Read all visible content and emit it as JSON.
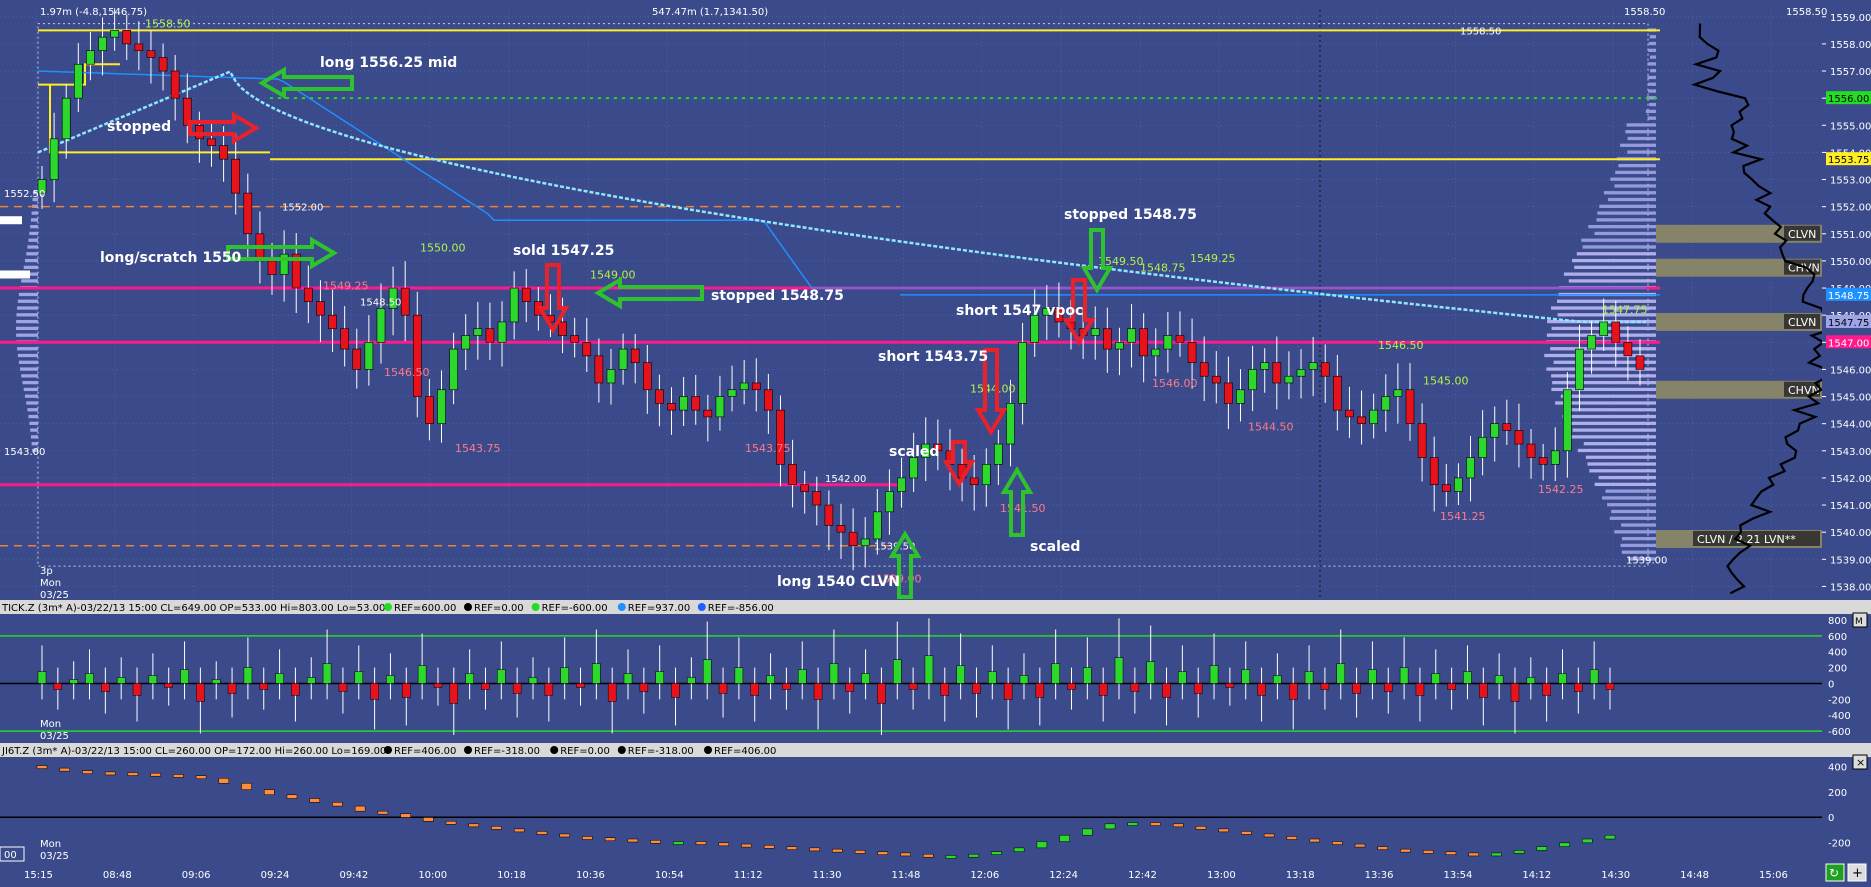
{
  "colors": {
    "background": "#3a4a8a",
    "grid": "#52609e",
    "up_candle": "#2bd82b",
    "down_candle": "#e8121c",
    "vwap_light": "#8fe8ff",
    "vwap_blue": "#1e90ff",
    "yellow_level": "#ffee22",
    "magenta_level": "#ff1a8c",
    "orange_dash": "#e8843c",
    "green_dotted": "#22dd22",
    "profile": "#9ea4e6",
    "profile_value": "#bdb8f4",
    "zone_fill": "#8e8a64",
    "arrow_green": "#2ec22e",
    "arrow_red": "#e8212b",
    "price_label_red": "#ff7a8a",
    "price_label_green": "#b6f04a",
    "annotation_text": "#ffffff"
  },
  "main_panel": {
    "header_left": "1.97m (-4.8,1546.75)",
    "header_mid": "547.47m (1.7,1341.50)",
    "header_right": "1558.50",
    "top_right_label": "1558.50",
    "price_axis_ticks": [
      "1559.00",
      "1558.00",
      "1557.00",
      "1556.00",
      "1555.00",
      "1554.00",
      "1553.00",
      "1552.00",
      "1551.00",
      "1550.00",
      "1549.00",
      "1548.00",
      "1547.00",
      "1546.00",
      "1545.00",
      "1544.00",
      "1543.00",
      "1542.00",
      "1541.00",
      "1540.00",
      "1539.00",
      "1538.00"
    ],
    "price_markers": [
      {
        "label": "1556.00",
        "price": 1556.0,
        "bg": "#22dd22",
        "fg": "#000000"
      },
      {
        "label": "1553.75",
        "price": 1553.75,
        "bg": "#ffee22",
        "fg": "#000000"
      },
      {
        "label": "1548.75",
        "price": 1548.75,
        "bg": "#1e90ff",
        "fg": "#ffffff"
      },
      {
        "label": "1547.75",
        "price": 1547.75,
        "bg": "#9ea4e6",
        "fg": "#000000"
      },
      {
        "label": "1547.00",
        "price": 1547.0,
        "bg": "#ff1a8c",
        "fg": "#ffffff"
      }
    ],
    "zones": [
      {
        "label": "CLVN",
        "price": 1551.0
      },
      {
        "label": "CHVN",
        "price": 1549.75
      },
      {
        "label": "CLVN",
        "price": 1547.75
      },
      {
        "label": "CHVN",
        "price": 1545.25
      },
      {
        "label": "CLVN / 2.21 LVN**",
        "price": 1539.75
      }
    ],
    "left_axis_labels": [
      {
        "text": "1552.50",
        "price": 1552.5
      },
      {
        "text": "1543.00",
        "price": 1543.0
      }
    ],
    "session_label_top": "3p",
    "session_label_day": "Mon",
    "session_label_date": "03/25",
    "inline_labels": [
      {
        "text": "1552.00",
        "price": 1552.0
      },
      {
        "text": "1548.50",
        "price": 1548.5
      },
      {
        "text": "1542.00",
        "price": 1542.0
      },
      {
        "text": "1539.50",
        "price": 1539.5
      },
      {
        "text": "1539.00",
        "price": 1539.0
      },
      {
        "text": "1558.50",
        "price": 1558.5
      }
    ],
    "swing_labels_green": [
      {
        "text": "1558.50",
        "price": 1558.5
      },
      {
        "text": "1550.00",
        "price": 1550.0
      },
      {
        "text": "1549.00",
        "price": 1549.0
      },
      {
        "text": "1549.50",
        "price": 1549.5
      },
      {
        "text": "1548.75",
        "price": 1548.75
      },
      {
        "text": "1549.25",
        "price": 1549.25
      },
      {
        "text": "1546.50",
        "price": 1546.5
      },
      {
        "text": "1545.00",
        "price": 1545.0
      },
      {
        "text": "1547.75",
        "price": 1547.75
      },
      {
        "text": "1544.00",
        "price": 1544.0
      }
    ],
    "swing_labels_red": [
      {
        "text": "1549.25",
        "price": 1549.25
      },
      {
        "text": "1546.50",
        "price": 1546.5
      },
      {
        "text": "1543.75",
        "price": 1543.75
      },
      {
        "text": "1543.75",
        "price": 1543.75
      },
      {
        "text": "1539.00",
        "price": 1539.0
      },
      {
        "text": "1541.50",
        "price": 1541.5
      },
      {
        "text": "1546.00",
        "price": 1546.0
      },
      {
        "text": "1544.50",
        "price": 1544.5
      },
      {
        "text": "1541.25",
        "price": 1541.25
      },
      {
        "text": "1542.25",
        "price": 1542.25
      }
    ],
    "annotations": [
      {
        "text": "long 1556.25 mid"
      },
      {
        "text": "stopped"
      },
      {
        "text": "long/scratch 1550"
      },
      {
        "text": "sold 1547.25"
      },
      {
        "text": "stopped 1548.75"
      },
      {
        "text": "short 1547 vpoc"
      },
      {
        "text": "stopped 1548.75"
      },
      {
        "text": "short 1543.75"
      },
      {
        "text": "scaled"
      },
      {
        "text": "scaled"
      },
      {
        "text": "long 1540 CLVN"
      }
    ]
  },
  "tick_panel": {
    "title": "TICK.Z (3m* A)-03/22/13 15:00 CL=649.00 OP=533.00 Hi=803.00 Lo=53.00",
    "refs": [
      {
        "text": "REF=600.00",
        "color": "#22dd22"
      },
      {
        "text": "REF=0.00",
        "color": "#000000"
      },
      {
        "text": "REF=-600.00",
        "color": "#22dd22"
      },
      {
        "text": "REF=937.00",
        "color": "#1e90ff"
      },
      {
        "text": "REF=-856.00",
        "color": "#1e60ff"
      }
    ],
    "axis_ticks": [
      "800",
      "600",
      "400",
      "200",
      "0",
      "-200",
      "-400",
      "-600"
    ],
    "day": "Mon",
    "date": "03/25"
  },
  "jiet_panel": {
    "title": "JI6T.Z (3m* A)-03/22/13 15:00 CL=260.00 OP=172.00 Hi=260.00 Lo=169.00",
    "refs": [
      {
        "text": "REF=406.00"
      },
      {
        "text": "REF=-318.00"
      },
      {
        "text": "REF=0.00"
      },
      {
        "text": "REF=-318.00"
      },
      {
        "text": "REF=406.00"
      }
    ],
    "axis_ticks": [
      "400",
      "200",
      "0",
      "-200"
    ],
    "day": "Mon",
    "date": "03/25",
    "corner_label": "00"
  },
  "time_axis": [
    "15:15",
    "08:48",
    "09:06",
    "09:24",
    "09:42",
    "10:00",
    "10:18",
    "10:36",
    "10:54",
    "11:12",
    "11:30",
    "11:48",
    "12:06",
    "12:24",
    "12:42",
    "13:00",
    "13:18",
    "13:36",
    "13:54",
    "14:12",
    "14:30",
    "14:48",
    "15:06"
  ],
  "chart_data": [
    {
      "type": "candlestick",
      "title": "",
      "xlabel": "",
      "ylabel": "",
      "ylim": [
        1537.5,
        1559.25
      ],
      "categories": [
        "15:15",
        "08:48",
        "09:06",
        "09:24",
        "09:42",
        "10:00",
        "10:18",
        "10:36",
        "10:54",
        "11:12",
        "11:30",
        "11:48",
        "12:06",
        "12:24",
        "12:42",
        "13:00",
        "13:18",
        "13:36",
        "13:54",
        "14:12",
        "14:30",
        "14:48",
        "15:06"
      ],
      "series": [
        {
          "values": [
            1553.0,
            1554.5,
            1556.0,
            1557.25,
            1557.75,
            1558.25,
            1558.5,
            1558.0,
            1557.75,
            1557.5,
            1557.0,
            1556.0,
            1555.0,
            1554.5,
            1554.25,
            1553.75,
            1552.5,
            1551.0,
            1550.0,
            1549.5,
            1550.25,
            1549.0,
            1548.5,
            1548.0,
            1547.5,
            1546.75,
            1546.0,
            1547.0,
            1548.25,
            1549.0,
            1548.0,
            1545.0,
            1544.0,
            1545.25,
            1546.75,
            1547.25,
            1547.5,
            1547.0,
            1547.75,
            1549.0,
            1548.5,
            1548.0,
            1547.75,
            1547.25,
            1547.0,
            1546.5,
            1545.5,
            1546.0,
            1546.75,
            1546.25,
            1545.25,
            1544.75,
            1544.5,
            1545.0,
            1544.5,
            1544.25,
            1545.0,
            1545.25,
            1545.5,
            1545.25,
            1544.5,
            1542.5,
            1541.75,
            1541.5,
            1541.0,
            1540.25,
            1540.0,
            1539.5,
            1539.75,
            1540.75,
            1541.5,
            1542.0,
            1542.75,
            1543.25,
            1543.0,
            1542.5,
            1542.0,
            1541.75,
            1542.5,
            1543.25,
            1544.75,
            1547.0,
            1548.0,
            1548.25,
            1547.75,
            1547.5,
            1547.25,
            1547.5,
            1546.75,
            1547.0,
            1547.5,
            1546.5,
            1546.75,
            1547.25,
            1547.0,
            1546.25,
            1545.75,
            1545.5,
            1544.75,
            1545.25,
            1546.0,
            1546.25,
            1545.5,
            1545.75,
            1546.0,
            1546.25,
            1545.75,
            1544.5,
            1544.25,
            1544.0,
            1544.5,
            1545.0,
            1545.25,
            1544.0,
            1542.75,
            1541.75,
            1541.5,
            1542.0,
            1542.75,
            1543.5,
            1544.0,
            1543.75,
            1543.25,
            1542.75,
            1542.5,
            1543.0,
            1545.25,
            1546.75,
            1547.25,
            1547.75,
            1547.0,
            1546.5,
            1546.0
          ]
        }
      ]
    },
    {
      "type": "bar",
      "title": "TICK.Z (3m* A)-03/22/13 15:00 CL=649.00 OP=533.00 Hi=803.00 Lo=53.00",
      "ylim": [
        -700,
        850
      ],
      "series": [
        {
          "values": [
            300,
            -150,
            100,
            250,
            -200,
            150,
            -300,
            200,
            -100,
            350,
            -450,
            100,
            -250,
            400,
            -150,
            250,
            -300,
            150,
            500,
            -200,
            300,
            -400,
            200,
            -350,
            450,
            -100,
            -500,
            250,
            -150,
            350,
            -250,
            150,
            -300,
            400,
            -100,
            500,
            -450,
            250,
            -200,
            300,
            -350,
            150,
            600,
            -250,
            400,
            -300,
            200,
            -150,
            350,
            -400,
            500,
            -200,
            250,
            -500,
            600,
            -150,
            700,
            -300,
            450,
            -250,
            300,
            -400,
            200,
            -350,
            500,
            -150,
            400,
            -300,
            650,
            -200,
            550,
            -350,
            300,
            -250,
            450,
            -100,
            350,
            -300,
            200,
            -400,
            300,
            -150,
            500,
            -250,
            350,
            -200,
            400,
            -300,
            250,
            -150,
            300,
            -350,
            200,
            -450,
            150,
            -300,
            250,
            -200,
            350,
            -150
          ]
        }
      ]
    },
    {
      "type": "bar",
      "title": "JI6T.Z (3m* A)-03/22/13 15:00 CL=260.00 OP=172.00 Hi=260.00 Lo=169.00",
      "ylim": [
        -330,
        460
      ],
      "series": [
        {
          "values": [
            380,
            360,
            350,
            345,
            340,
            330,
            320,
            300,
            260,
            210,
            170,
            140,
            110,
            80,
            40,
            20,
            -10,
            -40,
            -60,
            -80,
            -100,
            -120,
            -140,
            -160,
            -170,
            -180,
            -190,
            -200,
            -200,
            -210,
            -220,
            -230,
            -240,
            -250,
            -260,
            -270,
            -280,
            -290,
            -300,
            -310,
            -310,
            -300,
            -280,
            -250,
            -200,
            -150,
            -100,
            -60,
            -50,
            -60,
            -80,
            -100,
            -120,
            -140,
            -160,
            -180,
            -200,
            -220,
            -240,
            -260,
            -270,
            -280,
            -290,
            -300,
            -290,
            -270,
            -240,
            -210,
            -180,
            -150
          ]
        }
      ]
    }
  ]
}
